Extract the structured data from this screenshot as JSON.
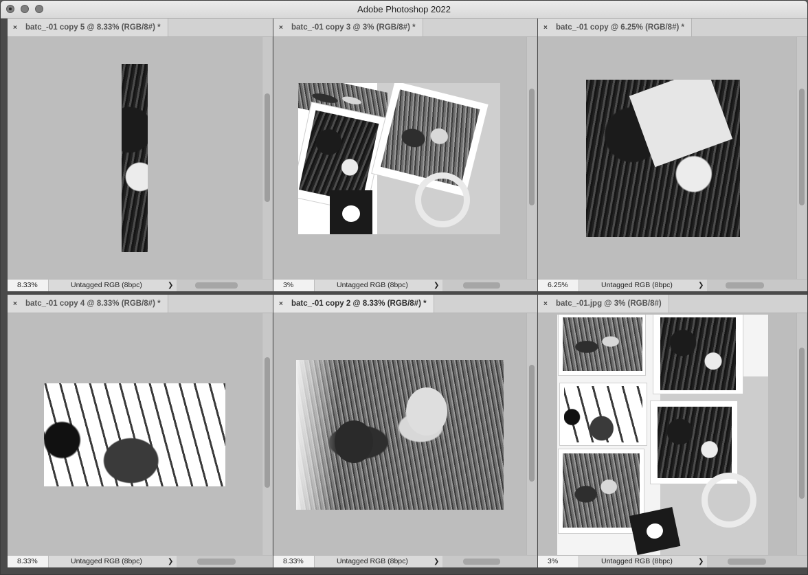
{
  "app": {
    "title": "Adobe Photoshop 2022"
  },
  "documents": [
    {
      "tab": "batc_-01 copy 5 @ 8.33% (RGB/8#) *",
      "zoom": "8.33%",
      "profile": "Untagged RGB (8bpc)",
      "active": false
    },
    {
      "tab": "batc_-01 copy 3 @ 3% (RGB/8#) *",
      "zoom": "3%",
      "profile": "Untagged RGB (8bpc)",
      "active": false
    },
    {
      "tab": "batc_-01 copy @ 6.25% (RGB/8#) *",
      "zoom": "6.25%",
      "profile": "Untagged RGB (8bpc)",
      "active": false
    },
    {
      "tab": "batc_-01 copy 4 @ 8.33% (RGB/8#) *",
      "zoom": "8.33%",
      "profile": "Untagged RGB (8bpc)",
      "active": false
    },
    {
      "tab": "batc_-01 copy 2 @ 8.33% (RGB/8#) *",
      "zoom": "8.33%",
      "profile": "Untagged RGB (8bpc)",
      "active": true
    },
    {
      "tab": "batc_-01.jpg @ 3% (RGB/8#)",
      "zoom": "3%",
      "profile": "Untagged RGB (8bpc)",
      "active": false
    }
  ],
  "icons": {
    "close_tab": "close-icon",
    "status_menu": "chevron-right-icon"
  },
  "glyphs": {
    "close": "×",
    "arrow": "❯"
  }
}
